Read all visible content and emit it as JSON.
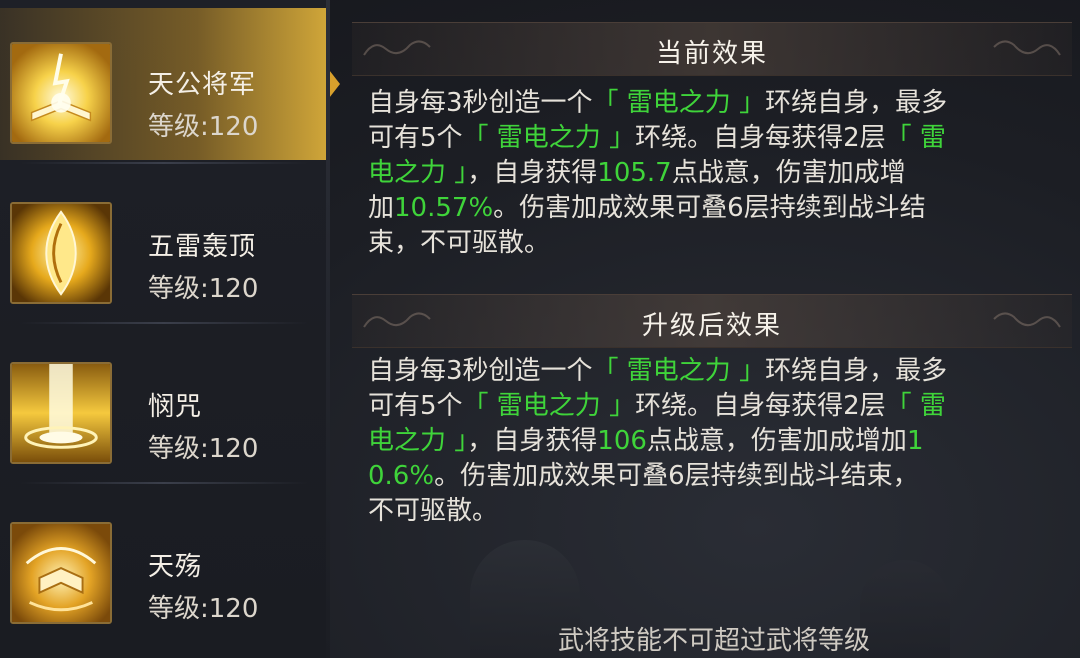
{
  "skills": [
    {
      "name": "天公将军",
      "level": "等级:120",
      "icon": "book-lightning-icon",
      "selected": true
    },
    {
      "name": "五雷轰顶",
      "level": "等级:120",
      "icon": "thunder-eye-icon",
      "selected": false
    },
    {
      "name": "悯咒",
      "level": "等级:120",
      "icon": "light-pillar-icon",
      "selected": false
    },
    {
      "name": "天殇",
      "level": "等级:120",
      "icon": "scroll-burst-icon",
      "selected": false
    }
  ],
  "current": {
    "title": "当前效果",
    "lines": [
      [
        {
          "t": "自身每3秒创造一个",
          "c": "d"
        },
        {
          "t": "「 雷电之力 」",
          "c": "g"
        },
        {
          "t": "环绕自身，最多",
          "c": "d"
        }
      ],
      [
        {
          "t": "可有5个",
          "c": "d"
        },
        {
          "t": "「 雷电之力 」",
          "c": "g"
        },
        {
          "t": "环绕。自身每获得2层",
          "c": "d"
        },
        {
          "t": "「 雷",
          "c": "g"
        }
      ],
      [
        {
          "t": "电之力 」",
          "c": "g"
        },
        {
          "t": "，自身获得",
          "c": "d"
        },
        {
          "t": "105.7",
          "c": "g"
        },
        {
          "t": "点战意，伤害加成增",
          "c": "d"
        }
      ],
      [
        {
          "t": "加",
          "c": "d"
        },
        {
          "t": "10.57%",
          "c": "g"
        },
        {
          "t": "。伤害加成效果可叠6层持续到战斗结",
          "c": "d"
        }
      ],
      [
        {
          "t": "束，不可驱散。",
          "c": "d"
        }
      ]
    ]
  },
  "upgraded": {
    "title": "升级后效果",
    "lines": [
      [
        {
          "t": "自身每3秒创造一个",
          "c": "d"
        },
        {
          "t": "「 雷电之力 」",
          "c": "g"
        },
        {
          "t": "环绕自身，最多",
          "c": "d"
        }
      ],
      [
        {
          "t": "可有5个",
          "c": "d"
        },
        {
          "t": "「 雷电之力 」",
          "c": "g"
        },
        {
          "t": "环绕。自身每获得2层",
          "c": "d"
        },
        {
          "t": "「 雷",
          "c": "g"
        }
      ],
      [
        {
          "t": "电之力 」",
          "c": "g"
        },
        {
          "t": "，自身获得",
          "c": "d"
        },
        {
          "t": "106",
          "c": "g"
        },
        {
          "t": "点战意，伤害加成增加",
          "c": "d"
        },
        {
          "t": "1",
          "c": "g"
        }
      ],
      [
        {
          "t": "0.6%",
          "c": "g"
        },
        {
          "t": "。伤害加成效果可叠6层持续到战斗结束，",
          "c": "d"
        }
      ],
      [
        {
          "t": "不可驱散。",
          "c": "d"
        }
      ]
    ]
  },
  "footer": {
    "text": "武将技能不可超过武将等级"
  },
  "colors": {
    "highlight": "#3fd43a",
    "selected": "#d8a02c",
    "text": "#e6e2da"
  }
}
